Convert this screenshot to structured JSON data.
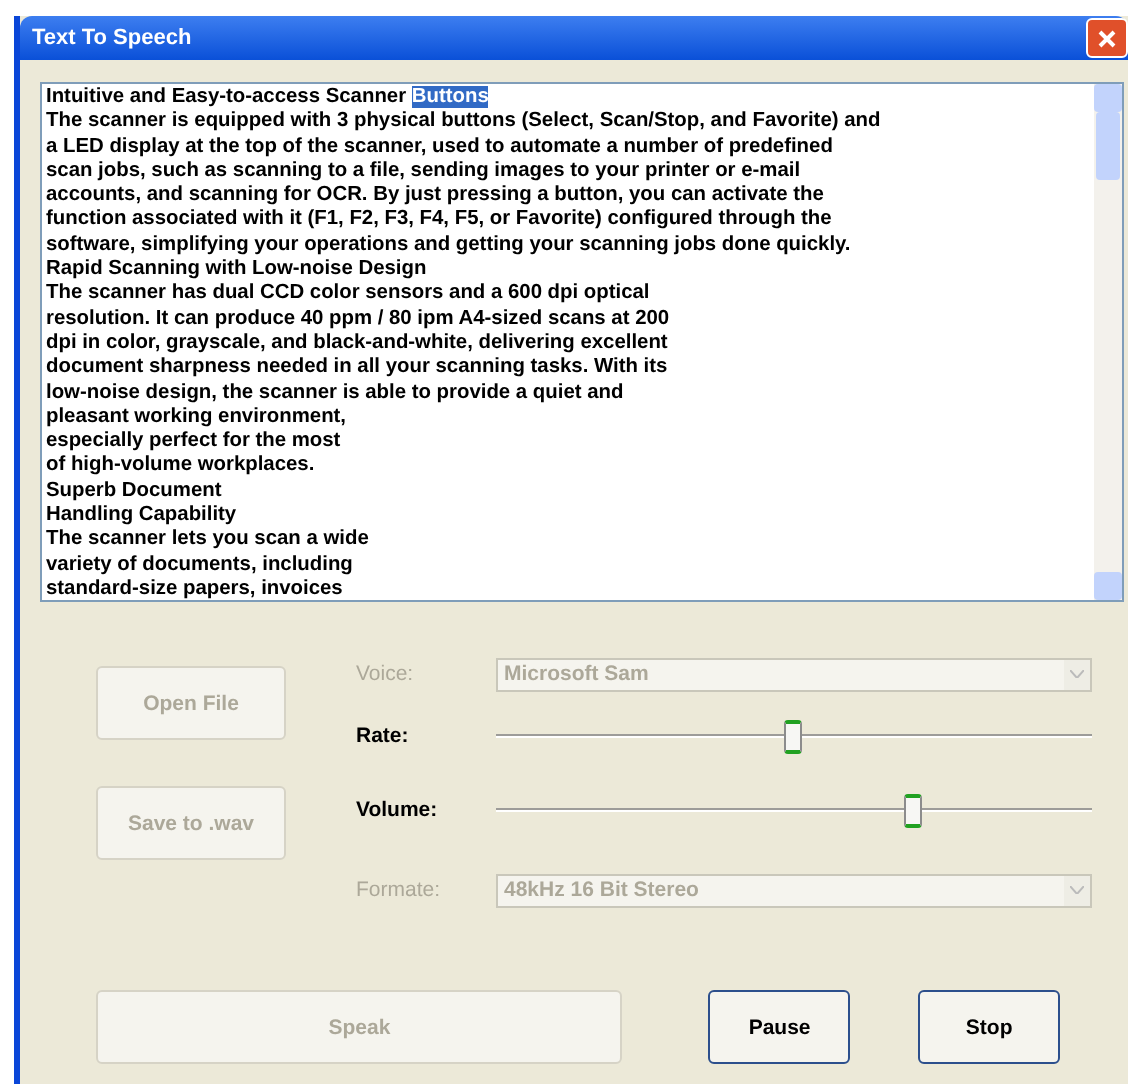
{
  "window": {
    "title": "Text To Speech"
  },
  "document": {
    "lines": [
      [
        {
          "text": "Intuitive and Easy-to-access Scanner ",
          "selected": false
        },
        {
          "text": "Buttons",
          "selected": true
        }
      ],
      [
        {
          "text": "The scanner is equipped with 3 physical buttons (Select, Scan/Stop, and Favorite) and",
          "selected": false
        }
      ],
      [
        {
          "text": "a LED display at the top of the scanner, used to automate a number of predefined",
          "selected": false
        }
      ],
      [
        {
          "text": "scan jobs, such as scanning to a file, sending images to your printer or e-mail",
          "selected": false
        }
      ],
      [
        {
          "text": "accounts, and scanning for OCR. By just pressing a button, you can activate the",
          "selected": false
        }
      ],
      [
        {
          "text": "function associated with it (F1, F2, F3, F4, F5, or Favorite) configured through the",
          "selected": false
        }
      ],
      [
        {
          "text": "software, simplifying your operations and getting your scanning jobs done quickly.",
          "selected": false
        }
      ],
      [
        {
          "text": "Rapid Scanning with Low-noise Design",
          "selected": false
        }
      ],
      [
        {
          "text": "The scanner has dual CCD color sensors and a 600 dpi optical",
          "selected": false
        }
      ],
      [
        {
          "text": "resolution. It can produce 40 ppm / 80 ipm A4-sized scans at 200",
          "selected": false
        }
      ],
      [
        {
          "text": "dpi in color, grayscale, and black-and-white, delivering excellent",
          "selected": false
        }
      ],
      [
        {
          "text": "document sharpness needed in all your scanning tasks. With its",
          "selected": false
        }
      ],
      [
        {
          "text": "low-noise design, the scanner is able to provide a quiet and",
          "selected": false
        }
      ],
      [
        {
          "text": "pleasant working environment,",
          "selected": false
        }
      ],
      [
        {
          "text": "especially perfect for the most",
          "selected": false
        }
      ],
      [
        {
          "text": "of high-volume workplaces.",
          "selected": false
        }
      ],
      [
        {
          "text": "Superb Document",
          "selected": false
        }
      ],
      [
        {
          "text": "Handling Capability",
          "selected": false
        }
      ],
      [
        {
          "text": "The scanner lets you scan a wide",
          "selected": false
        }
      ],
      [
        {
          "text": "variety of documents, including",
          "selected": false
        }
      ],
      [
        {
          "text": "standard-size papers, invoices",
          "selected": false
        }
      ]
    ]
  },
  "side_buttons": [
    {
      "label": "Open File",
      "disabled": true
    },
    {
      "label": "Save to .wav",
      "disabled": true
    }
  ],
  "settings": [
    {
      "kind": "dropdown",
      "label": "Voice:",
      "value": "Microsoft Sam",
      "disabled": true
    },
    {
      "kind": "slider",
      "label": "Rate:",
      "level": 0.5,
      "disabled": false
    },
    {
      "kind": "slider",
      "label": "Volume:",
      "level": 0.7,
      "disabled": false
    },
    {
      "kind": "dropdown",
      "label": "Formate:",
      "value": "48kHz 16 Bit Stereo",
      "disabled": true
    }
  ],
  "actions": [
    {
      "label": "Speak",
      "disabled": true,
      "kind": "wide"
    },
    {
      "label": "Pause",
      "disabled": false,
      "kind": "normal"
    },
    {
      "label": "Stop",
      "disabled": false,
      "kind": "normal"
    }
  ]
}
